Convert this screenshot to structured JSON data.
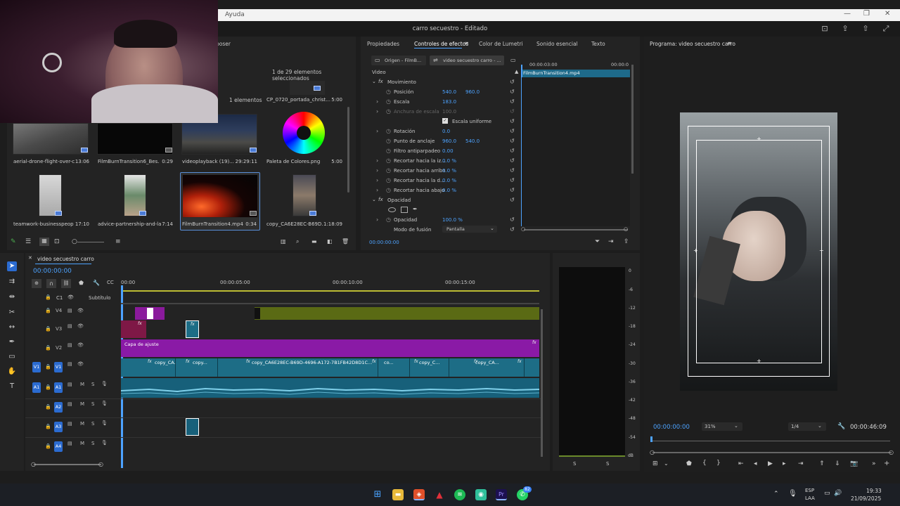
{
  "menubar": {
    "help": "Ayuda"
  },
  "title": "carro secuestro - Editado",
  "project": {
    "poser_label": "poser",
    "selection_count": "1 de 29 elementos seleccionados",
    "item_count": "1 elementos",
    "items": [
      {
        "name": "CP_0720_portada_christ...",
        "duration": "5:00"
      },
      {
        "name": "aerial-drone-flight-over-c...",
        "duration": "13:06"
      },
      {
        "name": "FilmBurnTransition6_Bes...",
        "duration": "0:29"
      },
      {
        "name": "videoplayback (19)...",
        "duration": "29:29:11"
      },
      {
        "name": "Paleta de Colores.png",
        "duration": "5:00"
      },
      {
        "name": "teamwork-businesspeop...",
        "duration": "17:10"
      },
      {
        "name": "advice-partnership-and-la...",
        "duration": "7:14"
      },
      {
        "name": "FilmBurnTransition4.mp4",
        "duration": "0:34"
      },
      {
        "name": "copy_CA6E28EC-B69D...",
        "duration": "1:18:09"
      }
    ]
  },
  "effects": {
    "tabs": [
      "Propiedades",
      "Controles de efectos",
      "Color de Lumetri",
      "Sonido esencial",
      "Texto"
    ],
    "source_tab": "Origen - FilmB...",
    "sequence_tab": "video secuestro carro - ...",
    "ruler_time_a": "00:00:03:00",
    "ruler_time_b": "00:00:0",
    "clip_name": "FilmBurnTransition4.mp4",
    "section_video": "Video",
    "movimiento": "Movimiento",
    "opacidad_section": "Opacidad",
    "params": [
      {
        "label": "Posición",
        "v1": "540.0",
        "v2": "960.0"
      },
      {
        "label": "Escala",
        "v1": "183.0",
        "v2": ""
      },
      {
        "label": "Anchura de escala",
        "v1": "100.0",
        "v2": ""
      },
      {
        "label": "Escala uniforme",
        "v1": "",
        "v2": ""
      },
      {
        "label": "Rotación",
        "v1": "0.0",
        "v2": ""
      },
      {
        "label": "Punto de anclaje",
        "v1": "960.0",
        "v2": "540.0"
      },
      {
        "label": "Filtro antiparpadeo",
        "v1": "0.00",
        "v2": ""
      },
      {
        "label": "Recortar hacia la iz...",
        "v1": "0.0 %",
        "v2": ""
      },
      {
        "label": "Recortar hacia arriba",
        "v1": "0.0 %",
        "v2": ""
      },
      {
        "label": "Recortar hacia la d...",
        "v1": "0.0 %",
        "v2": ""
      },
      {
        "label": "Recortar hacia abajo",
        "v1": "0.0 %",
        "v2": ""
      }
    ],
    "opacity_label": "Opacidad",
    "opacity_value": "100.0 %",
    "blend_label": "Modo de fusión",
    "blend_value": "Pantalla",
    "timecode": "00:00:00:00"
  },
  "program": {
    "title": "Programa: video secuestro carro",
    "timecode": "00:00:00:00",
    "zoom": "31%",
    "resolution": "1/4",
    "duration": "00:00:46:09"
  },
  "timeline": {
    "sequence_name": "video secuestro carro",
    "timecode": "00:00:00:00",
    "ruler": [
      "00:00",
      "00:00:05:00",
      "00:00:10:00",
      "00:00:15:00"
    ],
    "subtitle_track": "Subtítulo",
    "tracks_video": [
      "V4",
      "V3",
      "V2",
      "V1"
    ],
    "tracks_audio": [
      "A1",
      "A2",
      "A3",
      "A4"
    ],
    "adjust_layer": "Capa de ajuste",
    "c1": "C1",
    "v1_clips": [
      "copy_CA...",
      "copy...",
      "copy_CA6E28EC-B69D-4696-A172-7B1FB42D8D1C...",
      "co...",
      "copy_C...",
      "copy_CA..."
    ]
  },
  "meter": {
    "scale": [
      "0",
      "-6",
      "-12",
      "-18",
      "-24",
      "-30",
      "-36",
      "-42",
      "-48",
      "-54",
      "dB"
    ],
    "s_left": "S",
    "s_right": "S"
  },
  "taskbar": {
    "lang": "ESP",
    "layout": "LAA",
    "time": "19:33",
    "date": "21/09/2025",
    "whatsapp_badge": "82"
  }
}
